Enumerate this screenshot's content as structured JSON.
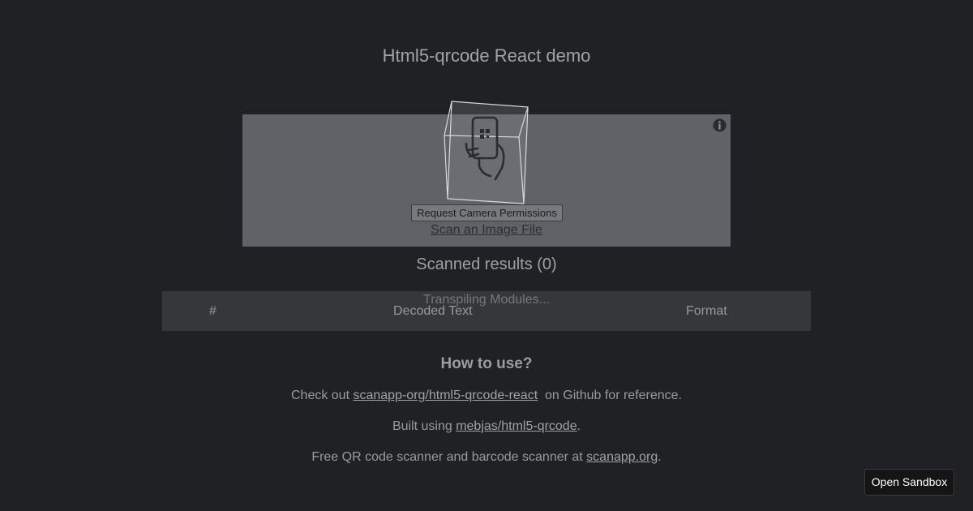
{
  "header": {
    "title": "Html5-qrcode React demo"
  },
  "scanner": {
    "request_permissions_label": "Request Camera Permissions",
    "scan_file_link": "Scan an Image File"
  },
  "results": {
    "heading": "Scanned results (0)",
    "columns": [
      "#",
      "Decoded Text",
      "Format"
    ],
    "loading_text": "Transpiling Modules..."
  },
  "howto": {
    "heading": "How to use?",
    "line1_prefix": "Check out ",
    "line1_link": "scanapp-org/html5-qrcode-react",
    "line1_suffix": "  on Github for reference.",
    "line2_prefix": "Built using ",
    "line2_link": "mebjas/html5-qrcode",
    "line2_suffix": ".",
    "line3_prefix": "Free QR code scanner and barcode scanner at ",
    "line3_link": "scanapp.org",
    "line3_suffix": "."
  },
  "sandbox": {
    "button_label": "Open Sandbox"
  },
  "icons": {
    "info": "info-icon",
    "scan": "scan-phone-icon"
  }
}
